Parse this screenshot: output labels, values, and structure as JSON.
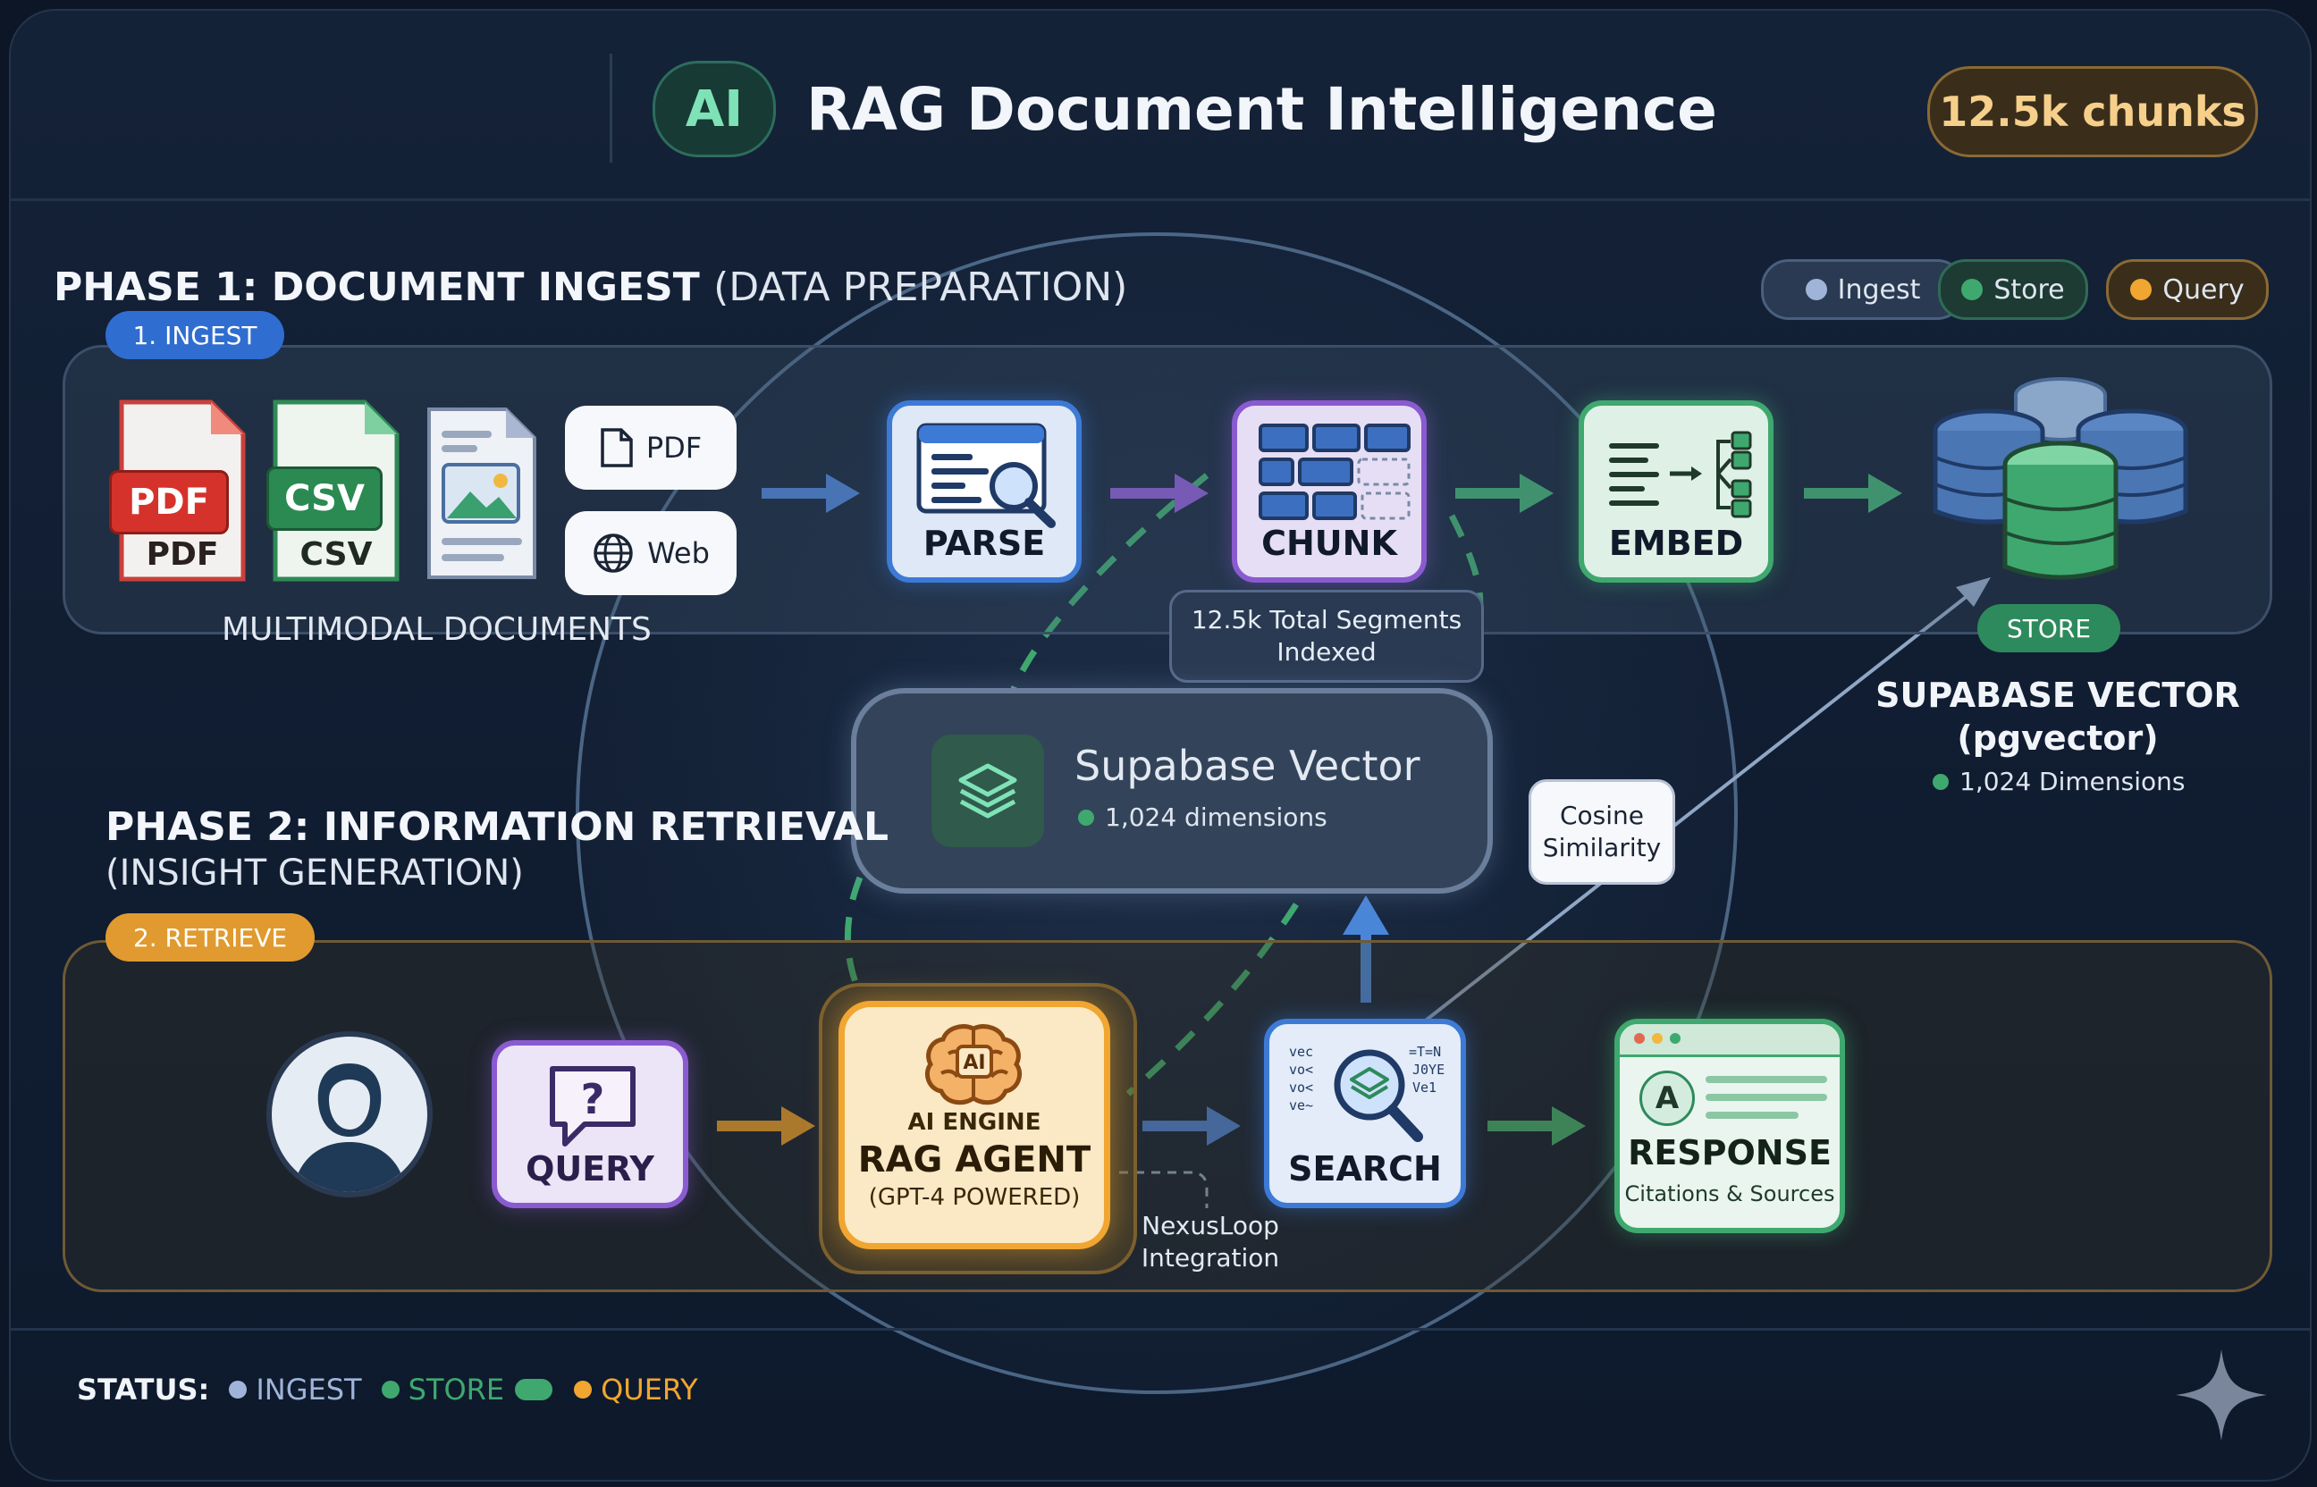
{
  "header": {
    "logo_text": "AI",
    "title": "RAG Document Intelligence",
    "chunks_badge": "12.5k chunks"
  },
  "legend": {
    "items": [
      {
        "label": "Ingest",
        "color": "#9fb4d8"
      },
      {
        "label": "Store",
        "color": "#3fa86f"
      },
      {
        "label": "Query",
        "color": "#f0a630"
      }
    ]
  },
  "phase1": {
    "title": "PHASE 1: DOCUMENT INGEST",
    "title_suffix": "(DATA PREPARATION)",
    "tag": "1. INGEST",
    "docs": {
      "pdf_badge": "PDF",
      "pdf_caption": "PDF",
      "csv_badge": "CSV",
      "csv_caption": "CSV",
      "pdf_button": "PDF",
      "web_button": "Web",
      "caption": "MULTIMODAL DOCUMENTS"
    },
    "steps": {
      "parse": "PARSE",
      "chunk": "CHUNK",
      "embed": "EMBED"
    },
    "segments_note": [
      "12.5k Total Segments",
      "Indexed"
    ]
  },
  "store": {
    "tag": "STORE",
    "title_line1": "SUPABASE VECTOR",
    "title_line2": "(pgvector)",
    "dimensions": "1,024 Dimensions"
  },
  "center": {
    "title": "Supabase Vector",
    "subtitle": "1,024 dimensions",
    "cosine": [
      "Cosine",
      "Similarity"
    ]
  },
  "phase2": {
    "title": "PHASE 2: INFORMATION RETRIEVAL",
    "subtitle": "(INSIGHT GENERATION)",
    "tag": "2. RETRIEVE",
    "query": "QUERY",
    "engine": {
      "kicker": "AI ENGINE",
      "title": "RAG AGENT",
      "subtitle": "(GPT-4 POWERED)",
      "brain_label": "AI"
    },
    "search": "SEARCH",
    "response": {
      "avatar_letter": "A",
      "title": "RESPONSE",
      "subtitle": "Citations & Sources"
    },
    "integration": [
      "NexusLoop",
      "Integration"
    ]
  },
  "status": {
    "label": "STATUS:",
    "items": [
      {
        "label": "INGEST",
        "color": "#9fb4d8"
      },
      {
        "label": "STORE",
        "color": "#3fa86f"
      },
      {
        "label": "QUERY",
        "color": "#f0a630"
      }
    ]
  }
}
